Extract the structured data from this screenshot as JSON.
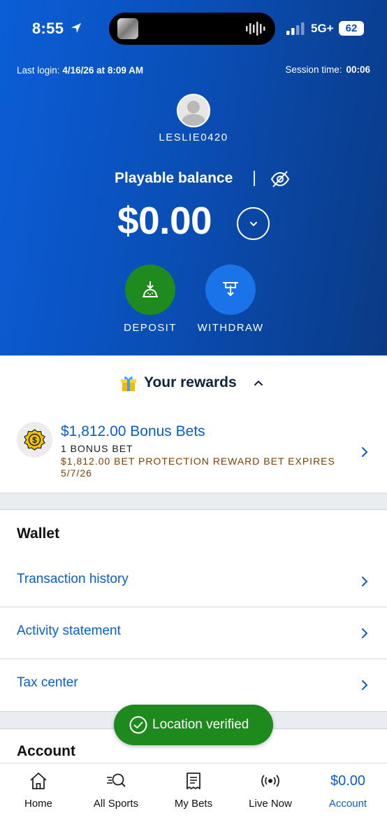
{
  "status_bar": {
    "time": "8:55",
    "network": "5G+",
    "battery": "62"
  },
  "session": {
    "last_login_label": "Last login:",
    "last_login_value": "4/16/26 at 8:09 AM",
    "session_time_label": "Session time:",
    "session_time_value": "00:06"
  },
  "user": {
    "username": "LESLIE0420"
  },
  "balance": {
    "label": "Playable balance",
    "amount": "$0.00"
  },
  "actions": {
    "deposit": "DEPOSIT",
    "withdraw": "WITHDRAW"
  },
  "rewards": {
    "title": "Your rewards",
    "bonus_title": "$1,812.00 Bonus Bets",
    "bonus_count": "1 BONUS BET",
    "bonus_detail": "$1,812.00 BET PROTECTION REWARD BET EXPIRES 5/7/26"
  },
  "wallet": {
    "title": "Wallet",
    "items": [
      {
        "label": "Transaction history"
      },
      {
        "label": "Activity statement"
      },
      {
        "label": "Tax center"
      }
    ]
  },
  "account": {
    "title": "Account"
  },
  "toast": {
    "text": "Location verified"
  },
  "bottom_nav": {
    "items": [
      {
        "label": "Home",
        "icon": "home-icon"
      },
      {
        "label": "All Sports",
        "icon": "sports-search-icon"
      },
      {
        "label": "My Bets",
        "icon": "betslip-icon"
      },
      {
        "label": "Live Now",
        "icon": "live-broadcast-icon"
      },
      {
        "label": "Account",
        "amount": "$0.00"
      }
    ]
  },
  "colors": {
    "hero_blue": "#0b5ed7",
    "link_blue": "#0a5ec9",
    "deposit_green": "#1f8b1f",
    "withdraw_blue": "#1a73e8",
    "expire_brown": "#7a3f00",
    "toast_green": "#1e8a1e"
  }
}
